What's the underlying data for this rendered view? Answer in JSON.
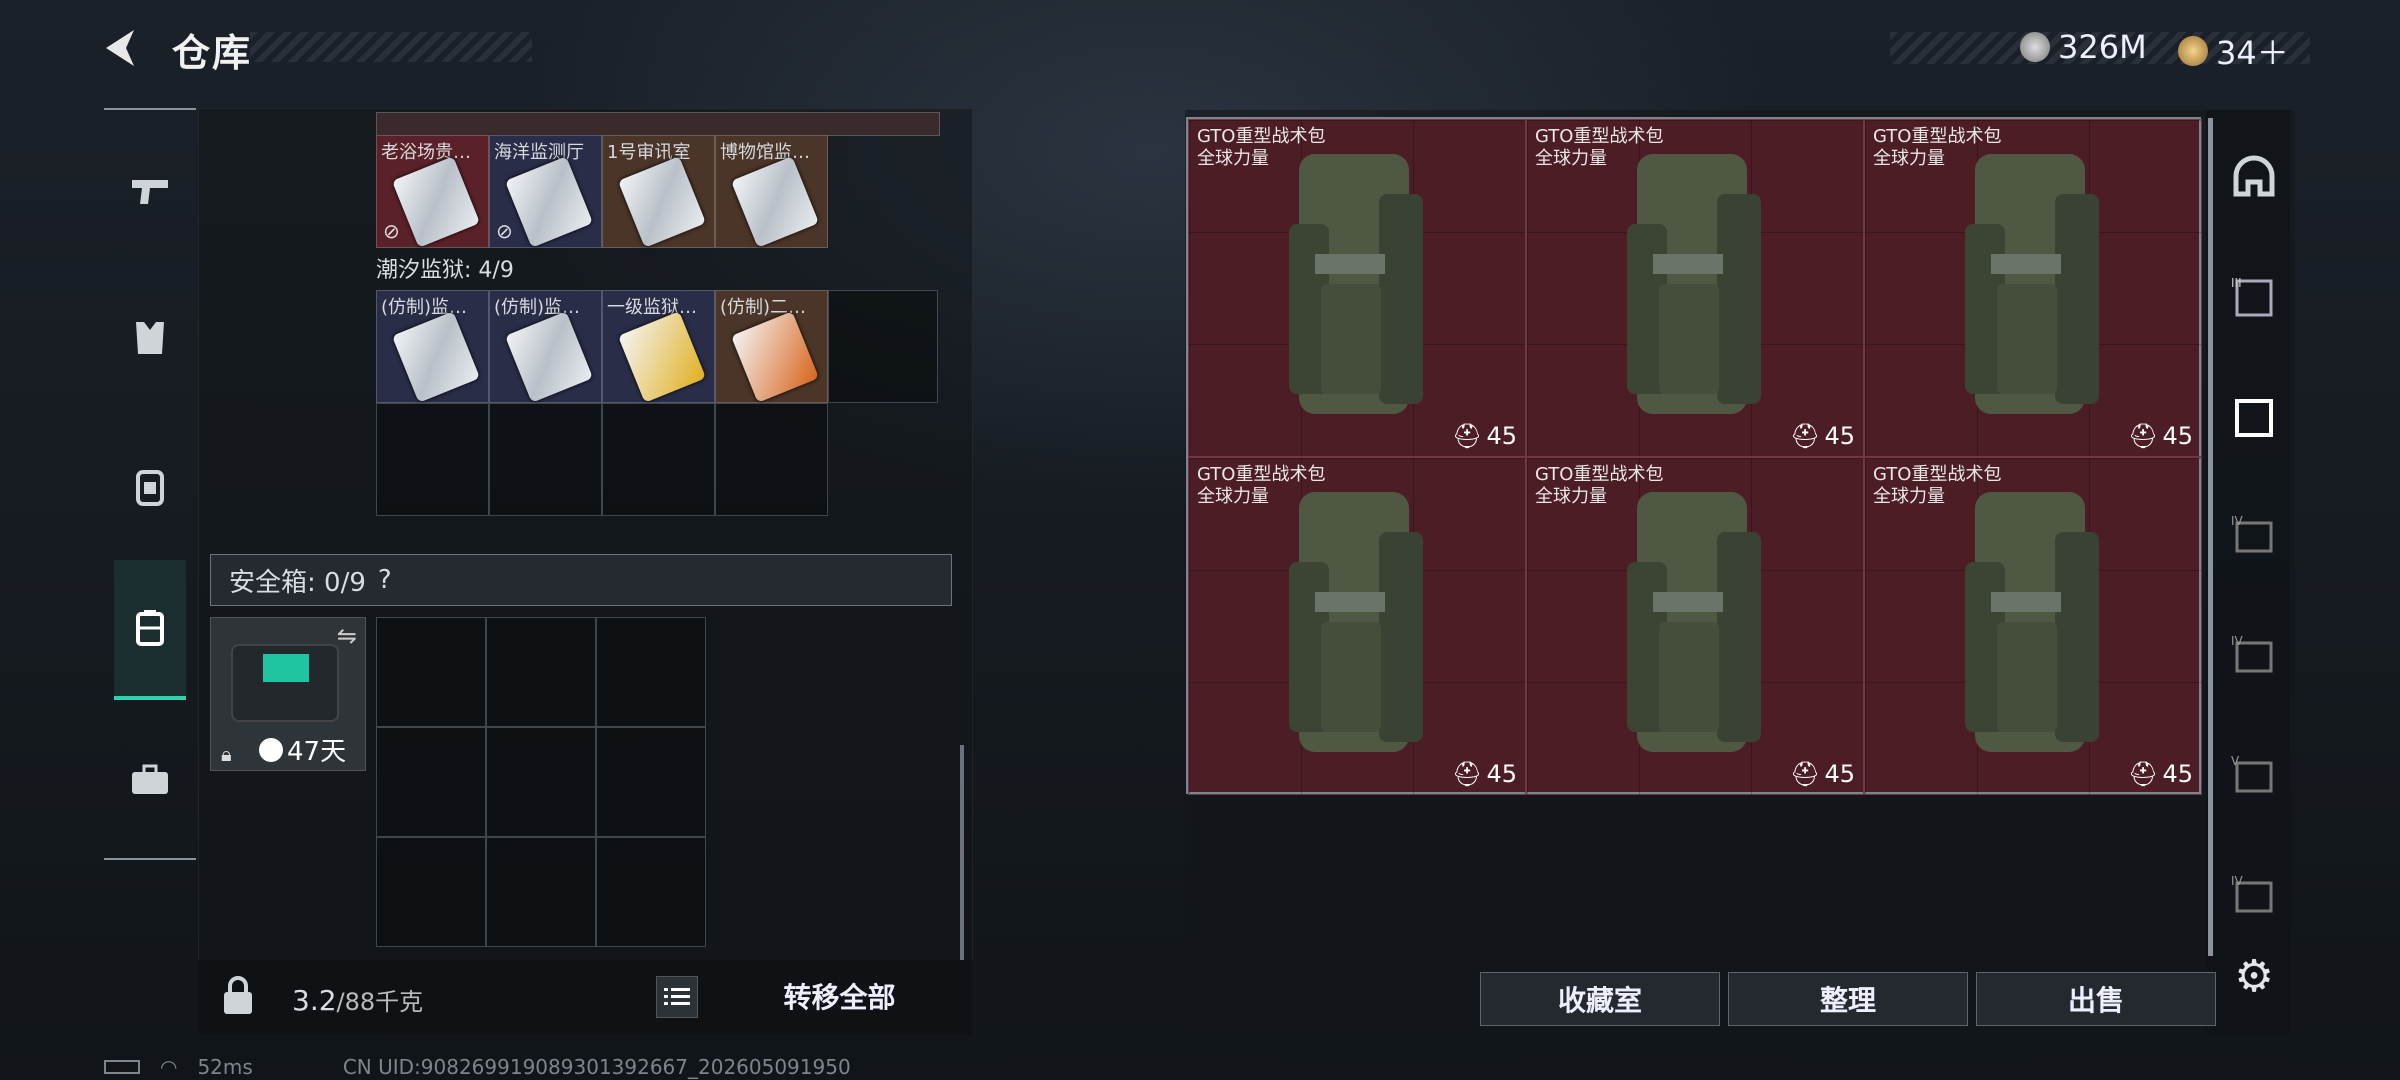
{
  "header": {
    "title": "仓库",
    "currency_silver": "326M",
    "currency_gold": "34＋"
  },
  "left_tabs": [
    "weapons",
    "armor",
    "backpack",
    "container",
    "toolbox"
  ],
  "top_cards": [
    "老浴场贵…",
    "海洋监测厅",
    "1号审讯室",
    "博物馆监…"
  ],
  "prison": {
    "label": "潮汐监狱: 4/9",
    "cards": [
      "(仿制)监…",
      "(仿制)监…",
      "一级监狱…",
      "(仿制)二…"
    ]
  },
  "safe": {
    "label": "安全箱: 0/9",
    "help": "?",
    "days": "47天"
  },
  "weight": {
    "value": "3.2",
    "max": "/88千克"
  },
  "transfer_label": "转移全部",
  "backpacks": [
    {
      "name": "GTO重型战术包",
      "sub": "全球力量",
      "cap": "45"
    },
    {
      "name": "GTO重型战术包",
      "sub": "全球力量",
      "cap": "45"
    },
    {
      "name": "GTO重型战术包",
      "sub": "全球力量",
      "cap": "45"
    },
    {
      "name": "GTO重型战术包",
      "sub": "全球力量",
      "cap": "45"
    },
    {
      "name": "GTO重型战术包",
      "sub": "全球力量",
      "cap": "45"
    },
    {
      "name": "GTO重型战术包",
      "sub": "全球力量",
      "cap": "45"
    }
  ],
  "buttons": {
    "collection": "收藏室",
    "organize": "整理",
    "sell": "出售"
  },
  "rail_labels": [
    "",
    "III",
    "",
    "IV",
    "IV",
    "V",
    "IV"
  ],
  "footer": {
    "ping": "52ms",
    "uid": "CN UID:908269919089301392667_202605091950"
  },
  "colors": {
    "accent": "#2fd1b1",
    "grid_red": "#4d1d26"
  }
}
